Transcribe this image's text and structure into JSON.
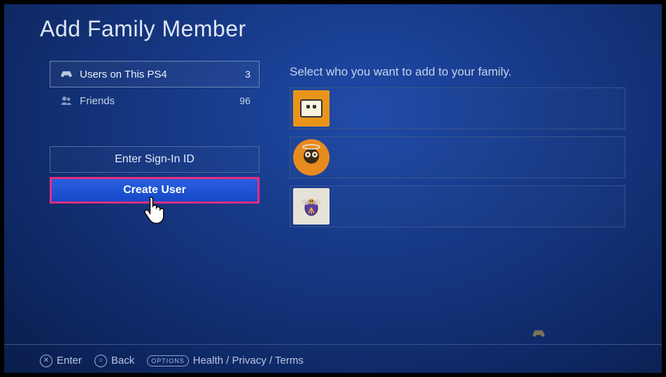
{
  "title": "Add Family Member",
  "left": {
    "tabs": [
      {
        "label": "Users on This PS4",
        "count": "3",
        "selected": true
      },
      {
        "label": "Friends",
        "count": "96",
        "selected": false
      }
    ],
    "actions": {
      "signin": "Enter Sign-In ID",
      "create": "Create User"
    }
  },
  "right": {
    "prompt": "Select who you want to add to your family."
  },
  "footer": {
    "enter": "Enter",
    "back": "Back",
    "options_badge": "OPTIONS",
    "legal": "Health / Privacy / Terms"
  }
}
